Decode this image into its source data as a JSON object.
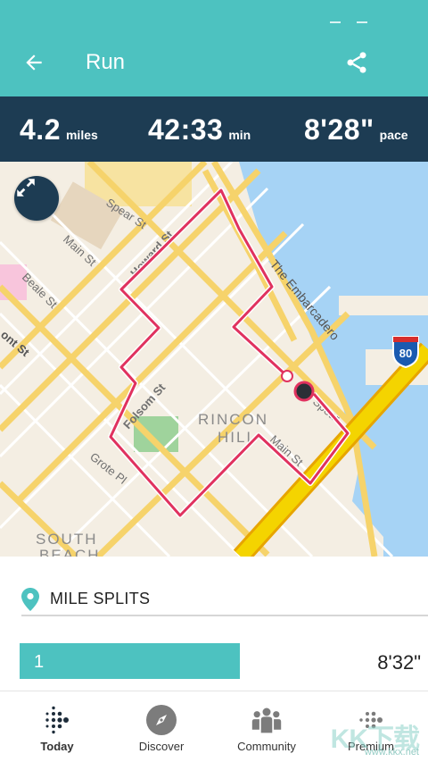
{
  "appbar": {
    "title": "Run",
    "back_icon": "arrow-left-icon",
    "share_icon": "share-icon",
    "color": "#4dc2c0"
  },
  "stats": {
    "distance_value": "4.2",
    "distance_unit": "miles",
    "time_value": "42:33",
    "time_unit": "min",
    "pace_value": "8'28\"",
    "pace_unit": "pace",
    "background": "#1d3c53"
  },
  "map": {
    "expand_icon": "expand-arrows-icon",
    "streets": [
      "Spear St",
      "Main St",
      "Beale St",
      "Howard St",
      "Folsom St",
      "Grote Pl",
      "The Embarcadero",
      "ont St",
      "Spear",
      "Main St"
    ],
    "districts": [
      "RINCON",
      "HILL",
      "SOUTH",
      "BEACH"
    ],
    "highway_shield": "80",
    "route_color": "#e0325f"
  },
  "splits": {
    "title": "MILE SPLITS",
    "pin_icon": "location-pin-icon",
    "rows": [
      {
        "mile": "1",
        "pace": "8'32\"",
        "fill": 0.54
      }
    ]
  },
  "nav": {
    "items": [
      {
        "label": "Today",
        "icon": "fitbit-dots-icon"
      },
      {
        "label": "Discover",
        "icon": "compass-icon"
      },
      {
        "label": "Community",
        "icon": "community-people-icon"
      },
      {
        "label": "Premium",
        "icon": "premium-dots-icon"
      }
    ]
  },
  "watermark": {
    "text": "KK下载",
    "url": "www.kkx.net"
  }
}
